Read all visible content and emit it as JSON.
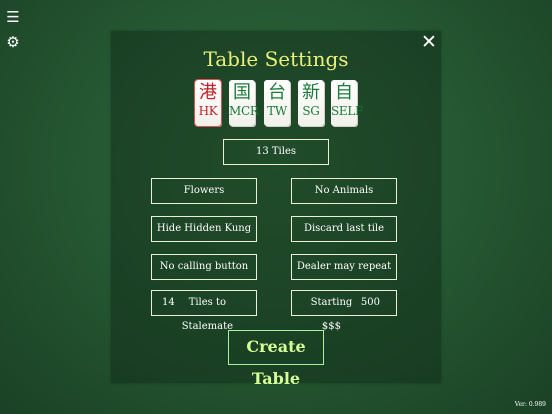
{
  "corner": {
    "menu_icon": "menu-icon",
    "gear_icon": "gear-icon"
  },
  "panel": {
    "title": "Table Settings",
    "close_icon": "close-icon",
    "tiles": [
      {
        "glyph": "港",
        "code": "HK",
        "color": "#c0202a",
        "selected": true
      },
      {
        "glyph": "国",
        "code": "MCR",
        "color": "#1a7a3a",
        "selected": false
      },
      {
        "glyph": "台",
        "code": "TW",
        "color": "#1a7a3a",
        "selected": false
      },
      {
        "glyph": "新",
        "code": "SG",
        "color": "#1a7a3a",
        "selected": false
      },
      {
        "glyph": "自",
        "code": "SELF",
        "color": "#1a7a3a",
        "selected": false
      }
    ],
    "tiles_count_label": "13 Tiles",
    "options": {
      "flowers": "Flowers",
      "animals": "No Animals",
      "hidden_kung": "Hide Hidden Kung",
      "discard_last": "Discard last tile",
      "calling_button": "No calling button",
      "dealer_repeat": "Dealer may repeat",
      "stalemate_value": "14",
      "stalemate_label": "Tiles to Stalemate",
      "starting_label": "Starting $$$",
      "starting_value": "500"
    },
    "create_label": "Create Table"
  },
  "version": "Ver: 0.989",
  "colors": {
    "background": "#245531",
    "title": "#e9f07a",
    "create_text": "#d6ff98",
    "create_border": "#aef0a0"
  }
}
